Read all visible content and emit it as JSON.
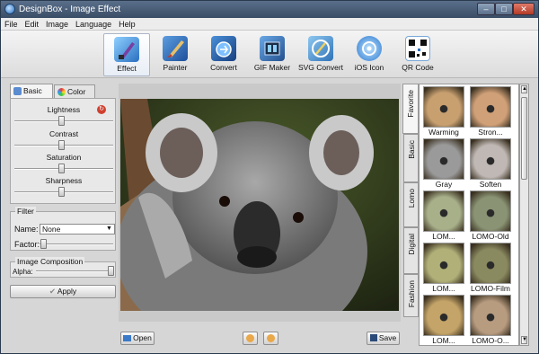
{
  "window": {
    "title": "DesignBox - Image Effect"
  },
  "menu": [
    "File",
    "Edit",
    "Image",
    "Language",
    "Help"
  ],
  "toolbar": {
    "tools": [
      {
        "label": "Effect",
        "icon": "effect-brush-icon",
        "active": true
      },
      {
        "label": "Painter",
        "icon": "paint-brush-icon"
      },
      {
        "label": "Convert",
        "icon": "convert-image-icon"
      },
      {
        "label": "GIF Maker",
        "icon": "gif-film-icon"
      },
      {
        "label": "SVG Convert",
        "icon": "svg-pen-icon"
      },
      {
        "label": "iOS Icon",
        "icon": "ios-icon"
      },
      {
        "label": "QR Code",
        "icon": "qr-code-icon"
      }
    ]
  },
  "left": {
    "tabs": {
      "basic": "Basic",
      "color": "Color"
    },
    "sliders": {
      "lightness": {
        "label": "Lightness",
        "value": 0.5
      },
      "contrast": {
        "label": "Contrast",
        "value": 0.5
      },
      "saturation": {
        "label": "Saturation",
        "value": 0.5
      },
      "sharpness": {
        "label": "Sharpness",
        "value": 0.5
      }
    },
    "filter": {
      "legend": "Filter",
      "name_label": "Name:",
      "name_value": "None",
      "factor_label": "Factor:",
      "factor_value": 0
    },
    "composition": {
      "legend": "Image Composition",
      "alpha_label": "Alpha:",
      "alpha_value": 1.0
    },
    "apply": "Apply"
  },
  "bottom": {
    "open": "Open",
    "save": "Save"
  },
  "categories": {
    "favorite": "Favorite",
    "basic": "Basic",
    "lomo": "Lomo",
    "digital": "Digital",
    "fashion": "Fashion"
  },
  "presets": [
    {
      "name": "Warming",
      "tint": "#c8a070"
    },
    {
      "name": "Stron...",
      "tint": "#d0a078"
    },
    {
      "name": "Gray",
      "tint": "#9a9a9a"
    },
    {
      "name": "Soften",
      "tint": "#c0b8b4"
    },
    {
      "name": "LOM...",
      "tint": "#a8b08a"
    },
    {
      "name": "LOMO-Old",
      "tint": "#8a9474"
    },
    {
      "name": "LOM...",
      "tint": "#b0b078"
    },
    {
      "name": "LOMO-Film",
      "tint": "#8a8a60"
    },
    {
      "name": "LOM...",
      "tint": "#c4a468"
    },
    {
      "name": "LOMO-O...",
      "tint": "#b89c80"
    }
  ],
  "colors": {
    "accent": "#2a6fc0",
    "close": "#b23a26"
  }
}
